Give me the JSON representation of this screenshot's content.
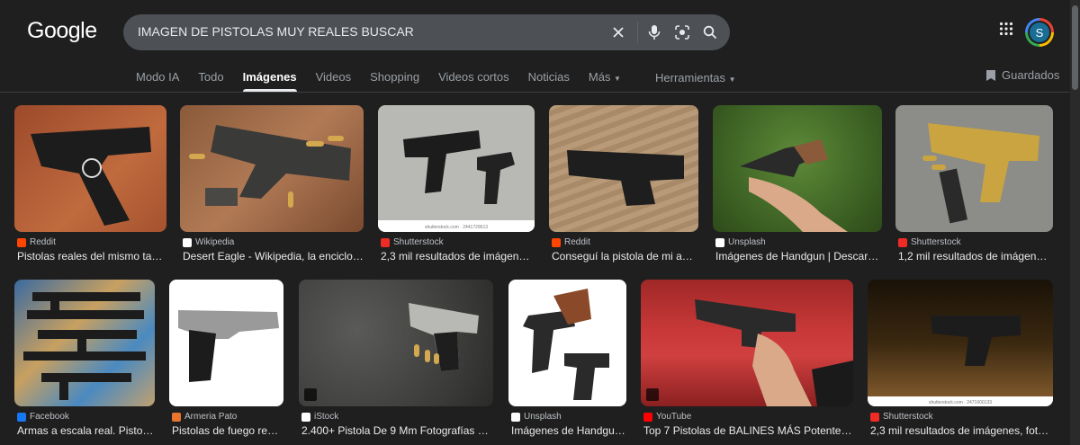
{
  "logo": "Google",
  "search": {
    "query": "IMAGEN DE PISTOLAS MUY REALES BUSCAR"
  },
  "icons": [
    "close-icon",
    "mic-icon",
    "lens-icon",
    "search-icon",
    "apps-icon",
    "bookmark-icon"
  ],
  "account": {
    "initial": "S"
  },
  "tabs": [
    "Modo IA",
    "Todo",
    "Imágenes",
    "Videos",
    "Shopping",
    "Videos cortos",
    "Noticias",
    "Más"
  ],
  "active_tab": "Imágenes",
  "tools_label": "Herramientas",
  "saved_label": "Guardados",
  "results": [
    {
      "source": "Reddit",
      "title": "Pistolas reales del mismo tam…",
      "source_color": "#ff4500"
    },
    {
      "source": "Wikipedia",
      "title": "Desert Eagle - Wikipedia, la enciclop…",
      "source_color": "#ffffff"
    },
    {
      "source": "Shutterstock",
      "title": "2,3 mil resultados de imágenes…",
      "source_color": "#ee2b24",
      "caption": "shutterstock.com · 2441729613"
    },
    {
      "source": "Reddit",
      "title": "Conseguí la pistola de mi ag…",
      "source_color": "#ff4500"
    },
    {
      "source": "Unsplash",
      "title": "Imágenes de Handgun | Descarg…",
      "source_color": "#ffffff"
    },
    {
      "source": "Shutterstock",
      "title": "1,2 mil resultados de imágenes…",
      "source_color": "#ee2b24"
    },
    {
      "source": "Facebook",
      "title": "Armas a escala real. Pistol…",
      "source_color": "#1877f2"
    },
    {
      "source": "Armeria Pato",
      "title": "Pistolas de fuego real…",
      "source_color": "#e8742d"
    },
    {
      "source": "iStock",
      "title": "2.400+ Pistola De 9 Mm Fotografías de …",
      "source_color": "#ffffff"
    },
    {
      "source": "Unsplash",
      "title": "Imágenes de Handgu…",
      "source_color": "#ffffff"
    },
    {
      "source": "YouTube",
      "title": "Top 7 Pistolas de BALINES MÁS Potentes …",
      "source_color": "#ff0000"
    },
    {
      "source": "Shutterstock",
      "title": "2,3 mil resultados de imágenes, foto…",
      "source_color": "#ee2b24",
      "caption": "shutterstock.com · 2471600133"
    }
  ]
}
